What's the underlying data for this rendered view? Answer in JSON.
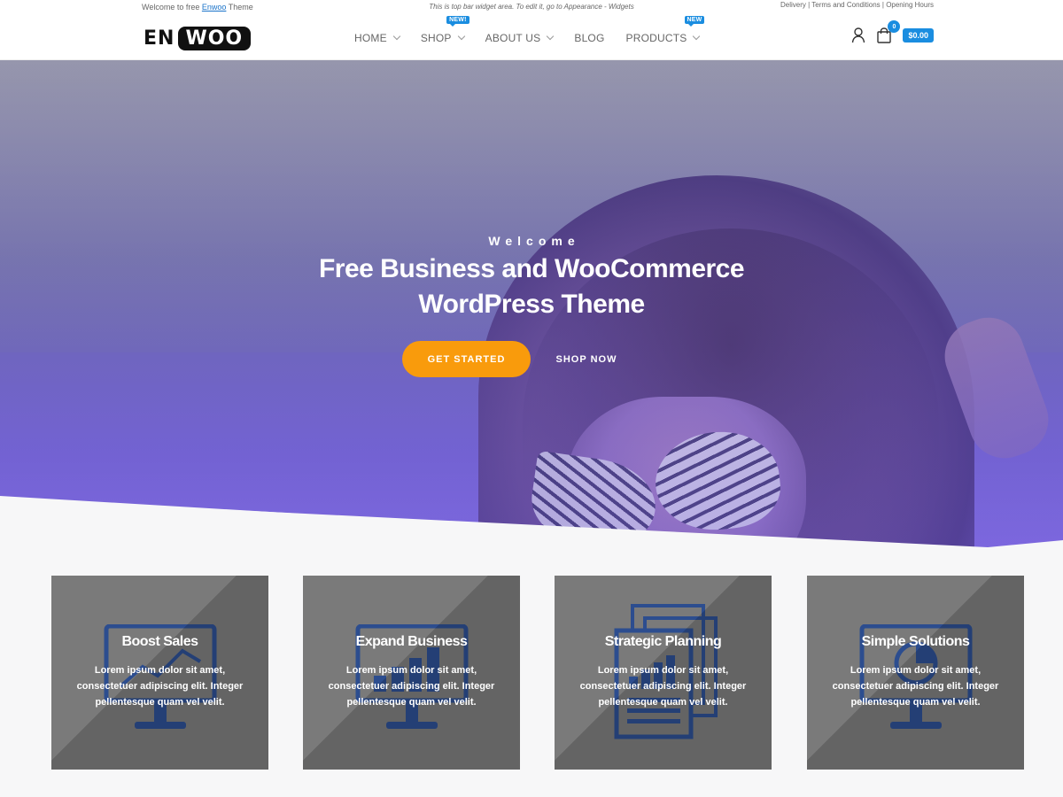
{
  "topbar": {
    "welcome_prefix": "Welcome to free ",
    "welcome_link": "Enwoo",
    "welcome_suffix": " Theme",
    "widget_note": "This is top bar widget area. To edit it, go to Appearance - Widgets",
    "links": [
      "Delivery",
      "Terms and Conditions",
      "Opening Hours"
    ],
    "separator": " | "
  },
  "header": {
    "logo_part1": "EN",
    "logo_part2": "WOO",
    "nav": [
      {
        "label": "HOME",
        "has_dropdown": true,
        "badge": ""
      },
      {
        "label": "SHOP",
        "has_dropdown": true,
        "badge": "NEW!"
      },
      {
        "label": "ABOUT US",
        "has_dropdown": true,
        "badge": ""
      },
      {
        "label": "BLOG",
        "has_dropdown": false,
        "badge": ""
      },
      {
        "label": "PRODUCTS",
        "has_dropdown": true,
        "badge": "NEW"
      }
    ],
    "cart_count": "0",
    "cart_total": "$0.00"
  },
  "hero": {
    "eyebrow": "Welcome",
    "title_line1": "Free Business and WooCommerce",
    "title_line2": "WordPress Theme",
    "primary_button": "GET STARTED",
    "secondary_button": "SHOP NOW"
  },
  "features": [
    {
      "title": "Boost Sales",
      "text": "Lorem ipsum dolor sit amet, consectetuer adipiscing elit. Integer pellentesque quam vel velit.",
      "icon": "monitor-chart-icon"
    },
    {
      "title": "Expand Business",
      "text": "Lorem ipsum dolor sit amet, consectetuer adipiscing elit. Integer pellentesque quam vel velit.",
      "icon": "monitor-bars-icon"
    },
    {
      "title": "Strategic Planning",
      "text": "Lorem ipsum dolor sit amet, consectetuer adipiscing elit. Integer pellentesque quam vel velit.",
      "icon": "documents-chart-icon"
    },
    {
      "title": "Simple Solutions",
      "text": "Lorem ipsum dolor sit amet, consectetuer adipiscing elit. Integer pellentesque quam vel velit.",
      "icon": "monitor-pie-icon"
    }
  ],
  "colors": {
    "accent_blue": "#1a8de0",
    "button_orange": "#f99b0c",
    "card_gray": "#7a7a7a",
    "icon_blue": "#2c4d8f"
  }
}
